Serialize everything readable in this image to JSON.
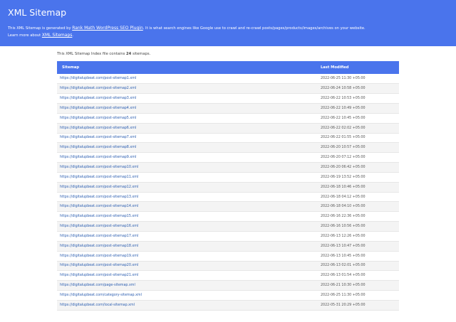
{
  "header": {
    "title": "XML Sitemap",
    "desc_prefix": "This XML Sitemap is generated by",
    "rank_math_link": "Rank Math WordPress SEO Plugin",
    "desc_suffix": ". It is what search engines like Google use to crawl and re-crawl posts/pages/products/images/archives on your website.",
    "learn_prefix": "Learn more about",
    "learn_link": "XML Sitemaps",
    "learn_suffix": "."
  },
  "intro": {
    "prefix": "This XML Sitemap Index file contains",
    "count": "24",
    "suffix": "sitemaps."
  },
  "table": {
    "col_sitemap": "Sitemap",
    "col_modified": "Last Modified",
    "rows": [
      {
        "url": "https://digitalupbeat.com/post-sitemap1.xml",
        "date": "2022-06-25 11:30 +05:00"
      },
      {
        "url": "https://digitalupbeat.com/post-sitemap2.xml",
        "date": "2022-06-24 10:58 +05:00"
      },
      {
        "url": "https://digitalupbeat.com/post-sitemap3.xml",
        "date": "2022-06-22 10:53 +05:00"
      },
      {
        "url": "https://digitalupbeat.com/post-sitemap4.xml",
        "date": "2022-06-22 10:49 +05:00"
      },
      {
        "url": "https://digitalupbeat.com/post-sitemap5.xml",
        "date": "2022-06-22 10:45 +05:00"
      },
      {
        "url": "https://digitalupbeat.com/post-sitemap6.xml",
        "date": "2022-06-22 02:02 +05:00"
      },
      {
        "url": "https://digitalupbeat.com/post-sitemap7.xml",
        "date": "2022-06-22 01:55 +05:00"
      },
      {
        "url": "https://digitalupbeat.com/post-sitemap8.xml",
        "date": "2022-06-20 10:57 +05:00"
      },
      {
        "url": "https://digitalupbeat.com/post-sitemap9.xml",
        "date": "2022-06-20 07:12 +05:00"
      },
      {
        "url": "https://digitalupbeat.com/post-sitemap10.xml",
        "date": "2022-06-20 06:42 +05:00"
      },
      {
        "url": "https://digitalupbeat.com/post-sitemap11.xml",
        "date": "2022-06-19 13:52 +05:00"
      },
      {
        "url": "https://digitalupbeat.com/post-sitemap12.xml",
        "date": "2022-06-18 10:46 +05:00"
      },
      {
        "url": "https://digitalupbeat.com/post-sitemap13.xml",
        "date": "2022-06-18 04:12 +05:00"
      },
      {
        "url": "https://digitalupbeat.com/post-sitemap14.xml",
        "date": "2022-06-18 04:10 +05:00"
      },
      {
        "url": "https://digitalupbeat.com/post-sitemap15.xml",
        "date": "2022-06-16 22:36 +05:00"
      },
      {
        "url": "https://digitalupbeat.com/post-sitemap16.xml",
        "date": "2022-06-16 10:56 +05:00"
      },
      {
        "url": "https://digitalupbeat.com/post-sitemap17.xml",
        "date": "2022-06-13 12:26 +05:00"
      },
      {
        "url": "https://digitalupbeat.com/post-sitemap18.xml",
        "date": "2022-06-13 10:47 +05:00"
      },
      {
        "url": "https://digitalupbeat.com/post-sitemap19.xml",
        "date": "2022-06-13 10:45 +05:00"
      },
      {
        "url": "https://digitalupbeat.com/post-sitemap20.xml",
        "date": "2022-06-13 02:01 +05:00"
      },
      {
        "url": "https://digitalupbeat.com/post-sitemap21.xml",
        "date": "2022-06-13 01:54 +05:00"
      },
      {
        "url": "https://digitalupbeat.com/page-sitemap.xml",
        "date": "2022-06-21 10:30 +05:00"
      },
      {
        "url": "https://digitalupbeat.com/category-sitemap.xml",
        "date": "2022-06-25 11:30 +05:00"
      },
      {
        "url": "https://digitalupbeat.com/local-sitemap.xml",
        "date": "2022-05-31 20:29 +05:00"
      }
    ]
  },
  "colors": {
    "accent": "#4a74ec",
    "link": "#2a5db0",
    "row_alt": "#f4f4f4"
  }
}
